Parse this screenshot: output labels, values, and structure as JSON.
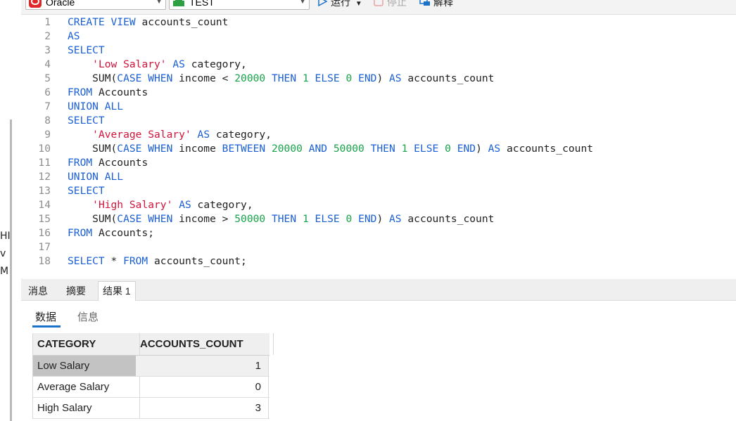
{
  "toolbar": {
    "connection": "Oracle",
    "database": "TEST",
    "run_label": "运行",
    "stop_label": "停止",
    "explain_label": "解释"
  },
  "left_strip": {
    "clipped_text": [
      "HI",
      "v",
      "M"
    ]
  },
  "editor": {
    "lines": [
      {
        "n": "1",
        "tokens": [
          {
            "t": "kw",
            "v": "CREATE VIEW"
          },
          {
            "t": "pl",
            "v": " accounts_count"
          }
        ]
      },
      {
        "n": "2",
        "tokens": [
          {
            "t": "kw",
            "v": "AS"
          }
        ]
      },
      {
        "n": "3",
        "tokens": [
          {
            "t": "kw",
            "v": "SELECT"
          }
        ]
      },
      {
        "n": "4",
        "tokens": [
          {
            "t": "pl",
            "v": "    "
          },
          {
            "t": "str",
            "v": "'Low Salary'"
          },
          {
            "t": "pl",
            "v": " "
          },
          {
            "t": "kw",
            "v": "AS"
          },
          {
            "t": "pl",
            "v": " category,"
          }
        ]
      },
      {
        "n": "5",
        "tokens": [
          {
            "t": "pl",
            "v": "    SUM("
          },
          {
            "t": "kw",
            "v": "CASE WHEN"
          },
          {
            "t": "pl",
            "v": " income < "
          },
          {
            "t": "num",
            "v": "20000"
          },
          {
            "t": "pl",
            "v": " "
          },
          {
            "t": "kw",
            "v": "THEN"
          },
          {
            "t": "pl",
            "v": " "
          },
          {
            "t": "num",
            "v": "1"
          },
          {
            "t": "pl",
            "v": " "
          },
          {
            "t": "kw",
            "v": "ELSE"
          },
          {
            "t": "pl",
            "v": " "
          },
          {
            "t": "num",
            "v": "0"
          },
          {
            "t": "pl",
            "v": " "
          },
          {
            "t": "kw",
            "v": "END"
          },
          {
            "t": "pl",
            "v": ") "
          },
          {
            "t": "kw",
            "v": "AS"
          },
          {
            "t": "pl",
            "v": " accounts_count"
          }
        ]
      },
      {
        "n": "6",
        "tokens": [
          {
            "t": "kw",
            "v": "FROM"
          },
          {
            "t": "pl",
            "v": " Accounts"
          }
        ]
      },
      {
        "n": "7",
        "tokens": [
          {
            "t": "kw",
            "v": "UNION ALL"
          }
        ]
      },
      {
        "n": "8",
        "tokens": [
          {
            "t": "kw",
            "v": "SELECT"
          }
        ]
      },
      {
        "n": "9",
        "tokens": [
          {
            "t": "pl",
            "v": "    "
          },
          {
            "t": "str",
            "v": "'Average Salary'"
          },
          {
            "t": "pl",
            "v": " "
          },
          {
            "t": "kw",
            "v": "AS"
          },
          {
            "t": "pl",
            "v": " category,"
          }
        ]
      },
      {
        "n": "10",
        "tokens": [
          {
            "t": "pl",
            "v": "    SUM("
          },
          {
            "t": "kw",
            "v": "CASE WHEN"
          },
          {
            "t": "pl",
            "v": " income "
          },
          {
            "t": "kw",
            "v": "BETWEEN"
          },
          {
            "t": "pl",
            "v": " "
          },
          {
            "t": "num",
            "v": "20000"
          },
          {
            "t": "pl",
            "v": " "
          },
          {
            "t": "kw",
            "v": "AND"
          },
          {
            "t": "pl",
            "v": " "
          },
          {
            "t": "num",
            "v": "50000"
          },
          {
            "t": "pl",
            "v": " "
          },
          {
            "t": "kw",
            "v": "THEN"
          },
          {
            "t": "pl",
            "v": " "
          },
          {
            "t": "num",
            "v": "1"
          },
          {
            "t": "pl",
            "v": " "
          },
          {
            "t": "kw",
            "v": "ELSE"
          },
          {
            "t": "pl",
            "v": " "
          },
          {
            "t": "num",
            "v": "0"
          },
          {
            "t": "pl",
            "v": " "
          },
          {
            "t": "kw",
            "v": "END"
          },
          {
            "t": "pl",
            "v": ") "
          },
          {
            "t": "kw",
            "v": "AS"
          },
          {
            "t": "pl",
            "v": " accounts_count"
          }
        ]
      },
      {
        "n": "11",
        "tokens": [
          {
            "t": "kw",
            "v": "FROM"
          },
          {
            "t": "pl",
            "v": " Accounts"
          }
        ]
      },
      {
        "n": "12",
        "tokens": [
          {
            "t": "kw",
            "v": "UNION ALL"
          }
        ]
      },
      {
        "n": "13",
        "tokens": [
          {
            "t": "kw",
            "v": "SELECT"
          }
        ]
      },
      {
        "n": "14",
        "tokens": [
          {
            "t": "pl",
            "v": "    "
          },
          {
            "t": "str",
            "v": "'High Salary'"
          },
          {
            "t": "pl",
            "v": " "
          },
          {
            "t": "kw",
            "v": "AS"
          },
          {
            "t": "pl",
            "v": " category,"
          }
        ]
      },
      {
        "n": "15",
        "tokens": [
          {
            "t": "pl",
            "v": "    SUM("
          },
          {
            "t": "kw",
            "v": "CASE WHEN"
          },
          {
            "t": "pl",
            "v": " income > "
          },
          {
            "t": "num",
            "v": "50000"
          },
          {
            "t": "pl",
            "v": " "
          },
          {
            "t": "kw",
            "v": "THEN"
          },
          {
            "t": "pl",
            "v": " "
          },
          {
            "t": "num",
            "v": "1"
          },
          {
            "t": "pl",
            "v": " "
          },
          {
            "t": "kw",
            "v": "ELSE"
          },
          {
            "t": "pl",
            "v": " "
          },
          {
            "t": "num",
            "v": "0"
          },
          {
            "t": "pl",
            "v": " "
          },
          {
            "t": "kw",
            "v": "END"
          },
          {
            "t": "pl",
            "v": ") "
          },
          {
            "t": "kw",
            "v": "AS"
          },
          {
            "t": "pl",
            "v": " accounts_count"
          }
        ]
      },
      {
        "n": "16",
        "tokens": [
          {
            "t": "kw",
            "v": "FROM"
          },
          {
            "t": "pl",
            "v": " Accounts;"
          }
        ]
      },
      {
        "n": "17",
        "tokens": []
      },
      {
        "n": "18",
        "tokens": [
          {
            "t": "kw",
            "v": "SELECT"
          },
          {
            "t": "pl",
            "v": " * "
          },
          {
            "t": "kw",
            "v": "FROM"
          },
          {
            "t": "pl",
            "v": " accounts_count;"
          }
        ]
      }
    ]
  },
  "result_tabs": [
    {
      "label": "消息",
      "active": false
    },
    {
      "label": "摘要",
      "active": false
    },
    {
      "label": "结果 1",
      "active": true
    }
  ],
  "sub_tabs": [
    {
      "label": "数据",
      "active": true
    },
    {
      "label": "信息",
      "active": false
    }
  ],
  "grid": {
    "columns": [
      "CATEGORY",
      "ACCOUNTS_COUNT"
    ],
    "rows": [
      {
        "category": "Low Salary",
        "accounts_count": "1",
        "selected": true
      },
      {
        "category": "Average Salary",
        "accounts_count": "0",
        "selected": false
      },
      {
        "category": "High Salary",
        "accounts_count": "3",
        "selected": false
      }
    ]
  },
  "colors": {
    "keyword": "#1a5fd6",
    "string": "#d2143c",
    "number": "#16a34a",
    "line_number": "#8e8e8e",
    "selected_cell": "#c3c3c3",
    "tab_underline": "#1a73c8"
  },
  "icons": {
    "connection": "oracle-icon",
    "database": "database-icon",
    "run": "play-icon",
    "stop": "stop-icon",
    "explain": "explain-icon"
  }
}
